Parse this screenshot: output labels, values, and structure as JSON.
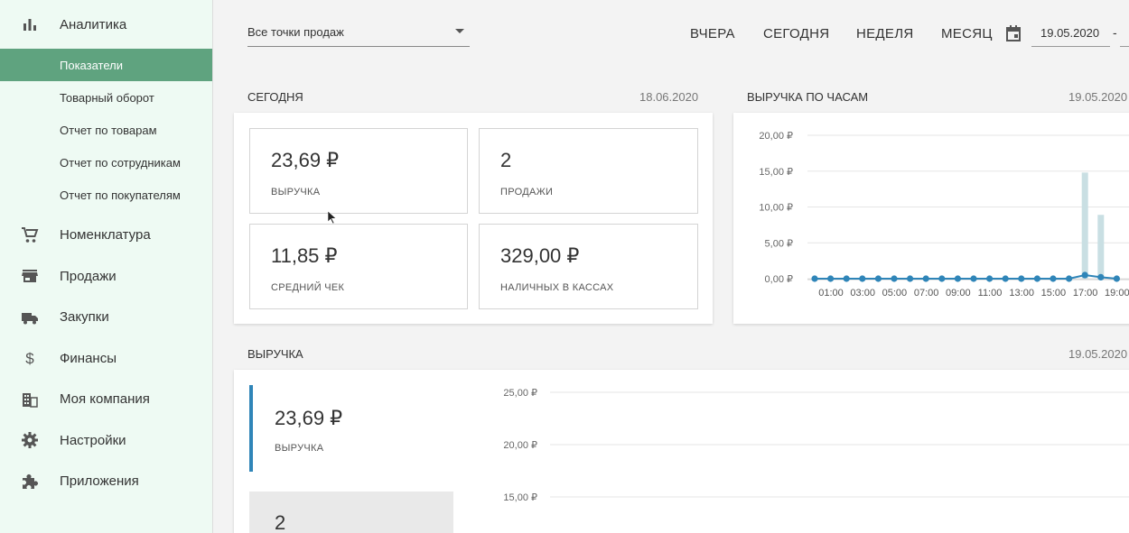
{
  "sidebar": {
    "top": {
      "label": "Аналитика",
      "icon": "bar-chart-icon"
    },
    "analytics_items": [
      {
        "label": "Показатели",
        "active": true
      },
      {
        "label": "Товарный оборот"
      },
      {
        "label": "Отчет по товарам"
      },
      {
        "label": "Отчет по сотрудникам"
      },
      {
        "label": "Отчет по покупателям"
      }
    ],
    "items": [
      {
        "label": "Номенклатура",
        "icon": "cart-icon"
      },
      {
        "label": "Продажи",
        "icon": "store-icon"
      },
      {
        "label": "Закупки",
        "icon": "truck-icon"
      },
      {
        "label": "Финансы",
        "icon": "dollar-icon"
      },
      {
        "label": "Моя компания",
        "icon": "building-icon"
      },
      {
        "label": "Настройки",
        "icon": "gear-icon"
      },
      {
        "label": "Приложения",
        "icon": "puzzle-icon"
      }
    ]
  },
  "toolbar": {
    "store_select": "Все точки продаж",
    "periods": [
      "ВЧЕРА",
      "СЕГОДНЯ",
      "НЕДЕЛЯ",
      "МЕСЯЦ"
    ],
    "date_from": "19.05.2020",
    "date_sep": "-"
  },
  "today": {
    "title": "СЕГОДНЯ",
    "date": "18.06.2020",
    "tiles": [
      {
        "value": "23,69 ₽",
        "label": "ВЫРУЧКА"
      },
      {
        "value": "2",
        "label": "ПРОДАЖИ"
      },
      {
        "value": "11,85 ₽",
        "label": "СРЕДНИЙ ЧЕК"
      },
      {
        "value": "329,00 ₽",
        "label": "НАЛИЧНЫХ В КАССАХ"
      }
    ]
  },
  "hourly": {
    "title": "ВЫРУЧКА ПО ЧАСАМ",
    "date": "19.05.2020",
    "chart_data": {
      "type": "bar",
      "y_ticks": [
        "20,00 ₽",
        "15,00 ₽",
        "10,00 ₽",
        "5,00 ₽",
        "0,00 ₽"
      ],
      "ylim": [
        0,
        20
      ],
      "x_tick_labels": [
        "01:00",
        "03:00",
        "05:00",
        "07:00",
        "09:00",
        "11:00",
        "13:00",
        "15:00",
        "17:00",
        "19:00"
      ],
      "bar_values": [
        0,
        0,
        0,
        0,
        0,
        0,
        0,
        0,
        0,
        0,
        0,
        0,
        0,
        0,
        0,
        0,
        0,
        14.8,
        8.9,
        0
      ],
      "line_values": [
        0,
        0,
        0,
        0,
        0,
        0,
        0,
        0,
        0,
        0,
        0,
        0,
        0,
        0,
        0,
        0,
        0,
        0.5,
        0.2,
        0
      ],
      "colors": {
        "bar": "#c9dfe3",
        "line": "#2f85b8"
      }
    }
  },
  "revenue": {
    "title": "ВЫРУЧКА",
    "date": "19.05.2020",
    "primary": {
      "value": "23,69 ₽",
      "label": "ВЫРУЧКА"
    },
    "secondary": {
      "value": "2"
    },
    "chart_data": {
      "type": "line",
      "y_ticks": [
        "25,00 ₽",
        "20,00 ₽",
        "15,00 ₽"
      ]
    }
  }
}
